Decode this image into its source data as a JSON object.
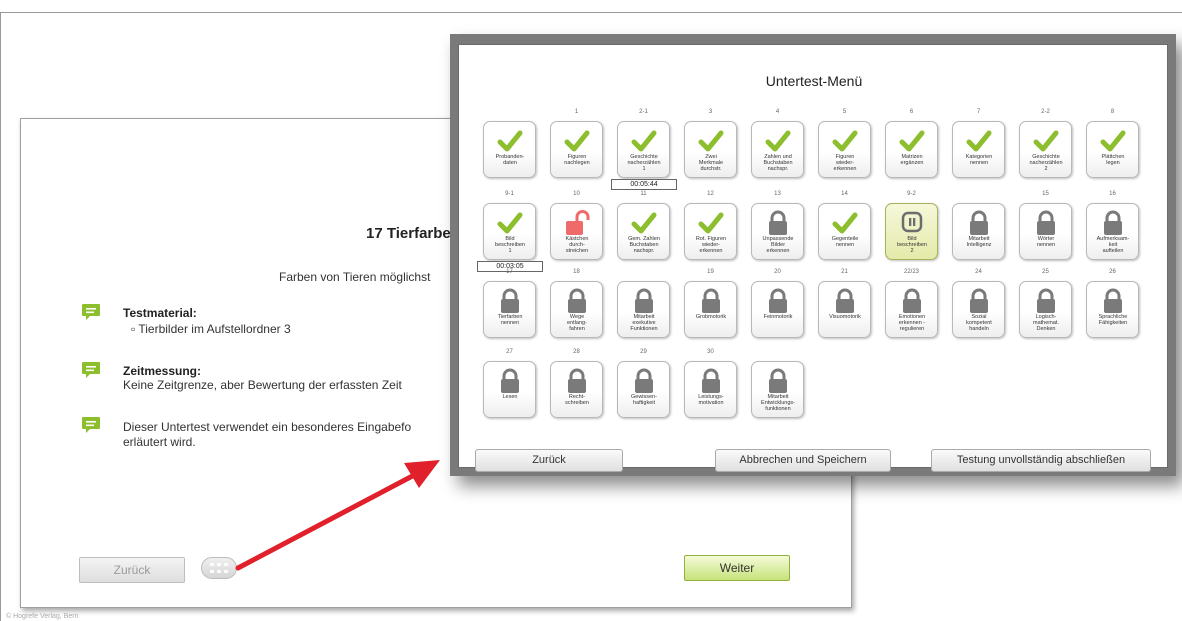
{
  "background_page": {
    "title": "17 Tierfarbe",
    "subtitle": "Farben von Tieren möglichst",
    "sections": [
      {
        "heading": "Testmaterial:",
        "lines": [
          "▫ Tierbilder im Aufstellordner 3"
        ]
      },
      {
        "heading": "Zeitmessung:",
        "lines": [
          "Keine Zeitgrenze, aber Bewertung der erfassten Zeit"
        ]
      },
      {
        "heading": "",
        "lines": [
          "Dieser Untertest verwendet ein besonderes Eingabefo",
          "erläutert wird."
        ]
      }
    ],
    "back_label": "Zurück",
    "next_label": "Weiter",
    "copyright": "© Hogrefe Verlag, Bern"
  },
  "modal": {
    "title": "Untertest-Menü",
    "tiles": [
      {
        "num": "",
        "label": "Probanden-\ndaten",
        "status": "done",
        "time": ""
      },
      {
        "num": "1",
        "label": "Figuren\nnachlegen",
        "status": "done",
        "time": ""
      },
      {
        "num": "2-1",
        "label": "Geschichte\nnacherzählen\n1",
        "status": "done",
        "time": "00:05:44"
      },
      {
        "num": "3",
        "label": "Zwei\nMerkmale\ndurchstr.",
        "status": "done",
        "time": ""
      },
      {
        "num": "4",
        "label": "Zahlen und\nBuchstaben\nnachspr.",
        "status": "done",
        "time": ""
      },
      {
        "num": "5",
        "label": "Figuren\nwieder-\nerkennen",
        "status": "done",
        "time": ""
      },
      {
        "num": "6",
        "label": "Matrizen\nergänzen",
        "status": "done",
        "time": ""
      },
      {
        "num": "7",
        "label": "Kategorien\nnennen",
        "status": "done",
        "time": ""
      },
      {
        "num": "2-2",
        "label": "Geschichte\nnacherzählen\n2",
        "status": "done",
        "time": ""
      },
      {
        "num": "8",
        "label": "Plättchen\nlegen",
        "status": "done",
        "time": ""
      },
      {
        "num": "9-1",
        "label": "Bild\nbeschreiben\n1",
        "status": "done",
        "time": "00:03:05"
      },
      {
        "num": "10",
        "label": "Kästchen\ndurch-\nstreichen",
        "status": "unlocked",
        "time": ""
      },
      {
        "num": "11",
        "label": "Gem. Zahlen\nBuchstaben\nnachspr.",
        "status": "done",
        "time": ""
      },
      {
        "num": "12",
        "label": "Rot. Figuren\nwieder-\nerkennen",
        "status": "done",
        "time": ""
      },
      {
        "num": "13",
        "label": "Unpassende\nBilder\nerkennen",
        "status": "locked",
        "time": ""
      },
      {
        "num": "14",
        "label": "Gegenteile\nnennen",
        "status": "done",
        "time": ""
      },
      {
        "num": "9-2",
        "label": "Bild\nbeschreiben\n2",
        "status": "paused",
        "time": ""
      },
      {
        "num": "",
        "label": "Mitarbeit\nIntelligenz",
        "status": "locked",
        "time": ""
      },
      {
        "num": "15",
        "label": "Wörter\nnennen",
        "status": "locked",
        "time": ""
      },
      {
        "num": "16",
        "label": "Aufmerksam-\nkeit\naufteilen",
        "status": "locked",
        "time": ""
      },
      {
        "num": "17",
        "label": "Tierfarben\nnennen",
        "status": "locked",
        "time": ""
      },
      {
        "num": "18",
        "label": "Wege\nentlang-\nfahren",
        "status": "locked",
        "time": ""
      },
      {
        "num": "",
        "label": "Mitarbeit\nexekutive\nFunktionen",
        "status": "locked",
        "time": ""
      },
      {
        "num": "19",
        "label": "Grobmotorik",
        "status": "locked",
        "time": ""
      },
      {
        "num": "20",
        "label": "Feinmotorik",
        "status": "locked",
        "time": ""
      },
      {
        "num": "21",
        "label": "Visuomotorik",
        "status": "locked",
        "time": ""
      },
      {
        "num": "22/23",
        "label": "Emotionen\nerkennen -\nregulieren",
        "status": "locked",
        "time": ""
      },
      {
        "num": "24",
        "label": "Sozial\nkompetent\nhandeln",
        "status": "locked",
        "time": ""
      },
      {
        "num": "25",
        "label": "Logisch-\nmathemat.\nDenken",
        "status": "locked",
        "time": ""
      },
      {
        "num": "26",
        "label": "Sprachliche\nFähigkeiten",
        "status": "locked",
        "time": ""
      },
      {
        "num": "27",
        "label": "Lesen",
        "status": "locked",
        "time": ""
      },
      {
        "num": "28",
        "label": "Recht-\nschreiben",
        "status": "locked",
        "time": ""
      },
      {
        "num": "29",
        "label": "Gewissen-\nhaftigkeit",
        "status": "locked",
        "time": ""
      },
      {
        "num": "30",
        "label": "Leistungs-\nmotivation",
        "status": "locked",
        "time": ""
      },
      {
        "num": "",
        "label": "Mitarbeit\nEntwicklungs-\nfunktionen",
        "status": "locked",
        "time": ""
      }
    ],
    "buttons": {
      "back": "Zurück",
      "cancel_save": "Abbrechen und Speichern",
      "finish_incomplete": "Testung unvollständig abschließen"
    }
  },
  "colors": {
    "check_green": "#8cbe2e",
    "lock_gray": "#7a7a7a",
    "unlock_red": "#ef6a6a",
    "accent_green": "#9bbf35",
    "arrow_red": "#e0202a"
  }
}
